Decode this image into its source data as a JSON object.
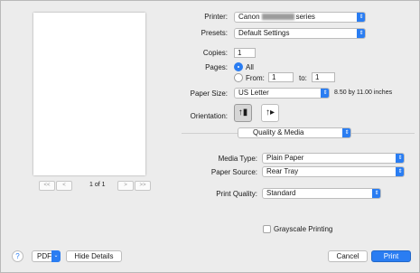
{
  "preview": {
    "page_indicator": "1 of 1",
    "nav": {
      "first": "<<",
      "prev": "<",
      "next": ">",
      "last": ">>"
    }
  },
  "printer": {
    "label": "Printer:",
    "value_prefix": "Canon",
    "value_suffix": "series"
  },
  "presets": {
    "label": "Presets:",
    "value": "Default Settings"
  },
  "copies": {
    "label": "Copies:",
    "value": "1"
  },
  "pages": {
    "label": "Pages:",
    "all_label": "All",
    "from_label": "From:",
    "from_value": "1",
    "to_label": "to:",
    "to_value": "1",
    "selected": "All"
  },
  "paper_size": {
    "label": "Paper Size:",
    "value": "US Letter",
    "dimensions": "8.50 by 11.00 inches"
  },
  "orientation": {
    "label": "Orientation:",
    "selected": "portrait"
  },
  "section": {
    "value": "Quality & Media"
  },
  "media_type": {
    "label": "Media Type:",
    "value": "Plain Paper"
  },
  "paper_source": {
    "label": "Paper Source:",
    "value": "Rear Tray"
  },
  "print_quality": {
    "label": "Print Quality:",
    "value": "Standard"
  },
  "grayscale": {
    "label": "Grayscale Printing",
    "checked": false
  },
  "footer": {
    "help": "?",
    "pdf": "PDF",
    "hide_details": "Hide Details",
    "cancel": "Cancel",
    "print": "Print"
  },
  "colors": {
    "accent": "#2a7df2"
  }
}
